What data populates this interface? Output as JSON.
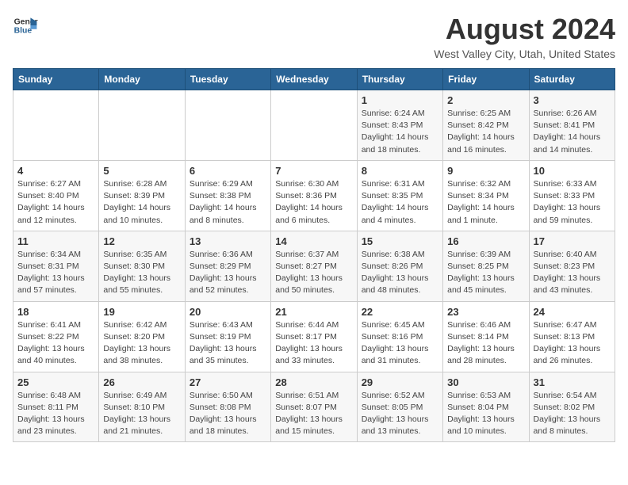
{
  "logo": {
    "general": "General",
    "blue": "Blue"
  },
  "title": "August 2024",
  "subtitle": "West Valley City, Utah, United States",
  "weekdays": [
    "Sunday",
    "Monday",
    "Tuesday",
    "Wednesday",
    "Thursday",
    "Friday",
    "Saturday"
  ],
  "weeks": [
    [
      {
        "day": "",
        "info": ""
      },
      {
        "day": "",
        "info": ""
      },
      {
        "day": "",
        "info": ""
      },
      {
        "day": "",
        "info": ""
      },
      {
        "day": "1",
        "info": "Sunrise: 6:24 AM\nSunset: 8:43 PM\nDaylight: 14 hours\nand 18 minutes."
      },
      {
        "day": "2",
        "info": "Sunrise: 6:25 AM\nSunset: 8:42 PM\nDaylight: 14 hours\nand 16 minutes."
      },
      {
        "day": "3",
        "info": "Sunrise: 6:26 AM\nSunset: 8:41 PM\nDaylight: 14 hours\nand 14 minutes."
      }
    ],
    [
      {
        "day": "4",
        "info": "Sunrise: 6:27 AM\nSunset: 8:40 PM\nDaylight: 14 hours\nand 12 minutes."
      },
      {
        "day": "5",
        "info": "Sunrise: 6:28 AM\nSunset: 8:39 PM\nDaylight: 14 hours\nand 10 minutes."
      },
      {
        "day": "6",
        "info": "Sunrise: 6:29 AM\nSunset: 8:38 PM\nDaylight: 14 hours\nand 8 minutes."
      },
      {
        "day": "7",
        "info": "Sunrise: 6:30 AM\nSunset: 8:36 PM\nDaylight: 14 hours\nand 6 minutes."
      },
      {
        "day": "8",
        "info": "Sunrise: 6:31 AM\nSunset: 8:35 PM\nDaylight: 14 hours\nand 4 minutes."
      },
      {
        "day": "9",
        "info": "Sunrise: 6:32 AM\nSunset: 8:34 PM\nDaylight: 14 hours\nand 1 minute."
      },
      {
        "day": "10",
        "info": "Sunrise: 6:33 AM\nSunset: 8:33 PM\nDaylight: 13 hours\nand 59 minutes."
      }
    ],
    [
      {
        "day": "11",
        "info": "Sunrise: 6:34 AM\nSunset: 8:31 PM\nDaylight: 13 hours\nand 57 minutes."
      },
      {
        "day": "12",
        "info": "Sunrise: 6:35 AM\nSunset: 8:30 PM\nDaylight: 13 hours\nand 55 minutes."
      },
      {
        "day": "13",
        "info": "Sunrise: 6:36 AM\nSunset: 8:29 PM\nDaylight: 13 hours\nand 52 minutes."
      },
      {
        "day": "14",
        "info": "Sunrise: 6:37 AM\nSunset: 8:27 PM\nDaylight: 13 hours\nand 50 minutes."
      },
      {
        "day": "15",
        "info": "Sunrise: 6:38 AM\nSunset: 8:26 PM\nDaylight: 13 hours\nand 48 minutes."
      },
      {
        "day": "16",
        "info": "Sunrise: 6:39 AM\nSunset: 8:25 PM\nDaylight: 13 hours\nand 45 minutes."
      },
      {
        "day": "17",
        "info": "Sunrise: 6:40 AM\nSunset: 8:23 PM\nDaylight: 13 hours\nand 43 minutes."
      }
    ],
    [
      {
        "day": "18",
        "info": "Sunrise: 6:41 AM\nSunset: 8:22 PM\nDaylight: 13 hours\nand 40 minutes."
      },
      {
        "day": "19",
        "info": "Sunrise: 6:42 AM\nSunset: 8:20 PM\nDaylight: 13 hours\nand 38 minutes."
      },
      {
        "day": "20",
        "info": "Sunrise: 6:43 AM\nSunset: 8:19 PM\nDaylight: 13 hours\nand 35 minutes."
      },
      {
        "day": "21",
        "info": "Sunrise: 6:44 AM\nSunset: 8:17 PM\nDaylight: 13 hours\nand 33 minutes."
      },
      {
        "day": "22",
        "info": "Sunrise: 6:45 AM\nSunset: 8:16 PM\nDaylight: 13 hours\nand 31 minutes."
      },
      {
        "day": "23",
        "info": "Sunrise: 6:46 AM\nSunset: 8:14 PM\nDaylight: 13 hours\nand 28 minutes."
      },
      {
        "day": "24",
        "info": "Sunrise: 6:47 AM\nSunset: 8:13 PM\nDaylight: 13 hours\nand 26 minutes."
      }
    ],
    [
      {
        "day": "25",
        "info": "Sunrise: 6:48 AM\nSunset: 8:11 PM\nDaylight: 13 hours\nand 23 minutes."
      },
      {
        "day": "26",
        "info": "Sunrise: 6:49 AM\nSunset: 8:10 PM\nDaylight: 13 hours\nand 21 minutes."
      },
      {
        "day": "27",
        "info": "Sunrise: 6:50 AM\nSunset: 8:08 PM\nDaylight: 13 hours\nand 18 minutes."
      },
      {
        "day": "28",
        "info": "Sunrise: 6:51 AM\nSunset: 8:07 PM\nDaylight: 13 hours\nand 15 minutes."
      },
      {
        "day": "29",
        "info": "Sunrise: 6:52 AM\nSunset: 8:05 PM\nDaylight: 13 hours\nand 13 minutes."
      },
      {
        "day": "30",
        "info": "Sunrise: 6:53 AM\nSunset: 8:04 PM\nDaylight: 13 hours\nand 10 minutes."
      },
      {
        "day": "31",
        "info": "Sunrise: 6:54 AM\nSunset: 8:02 PM\nDaylight: 13 hours\nand 8 minutes."
      }
    ]
  ]
}
